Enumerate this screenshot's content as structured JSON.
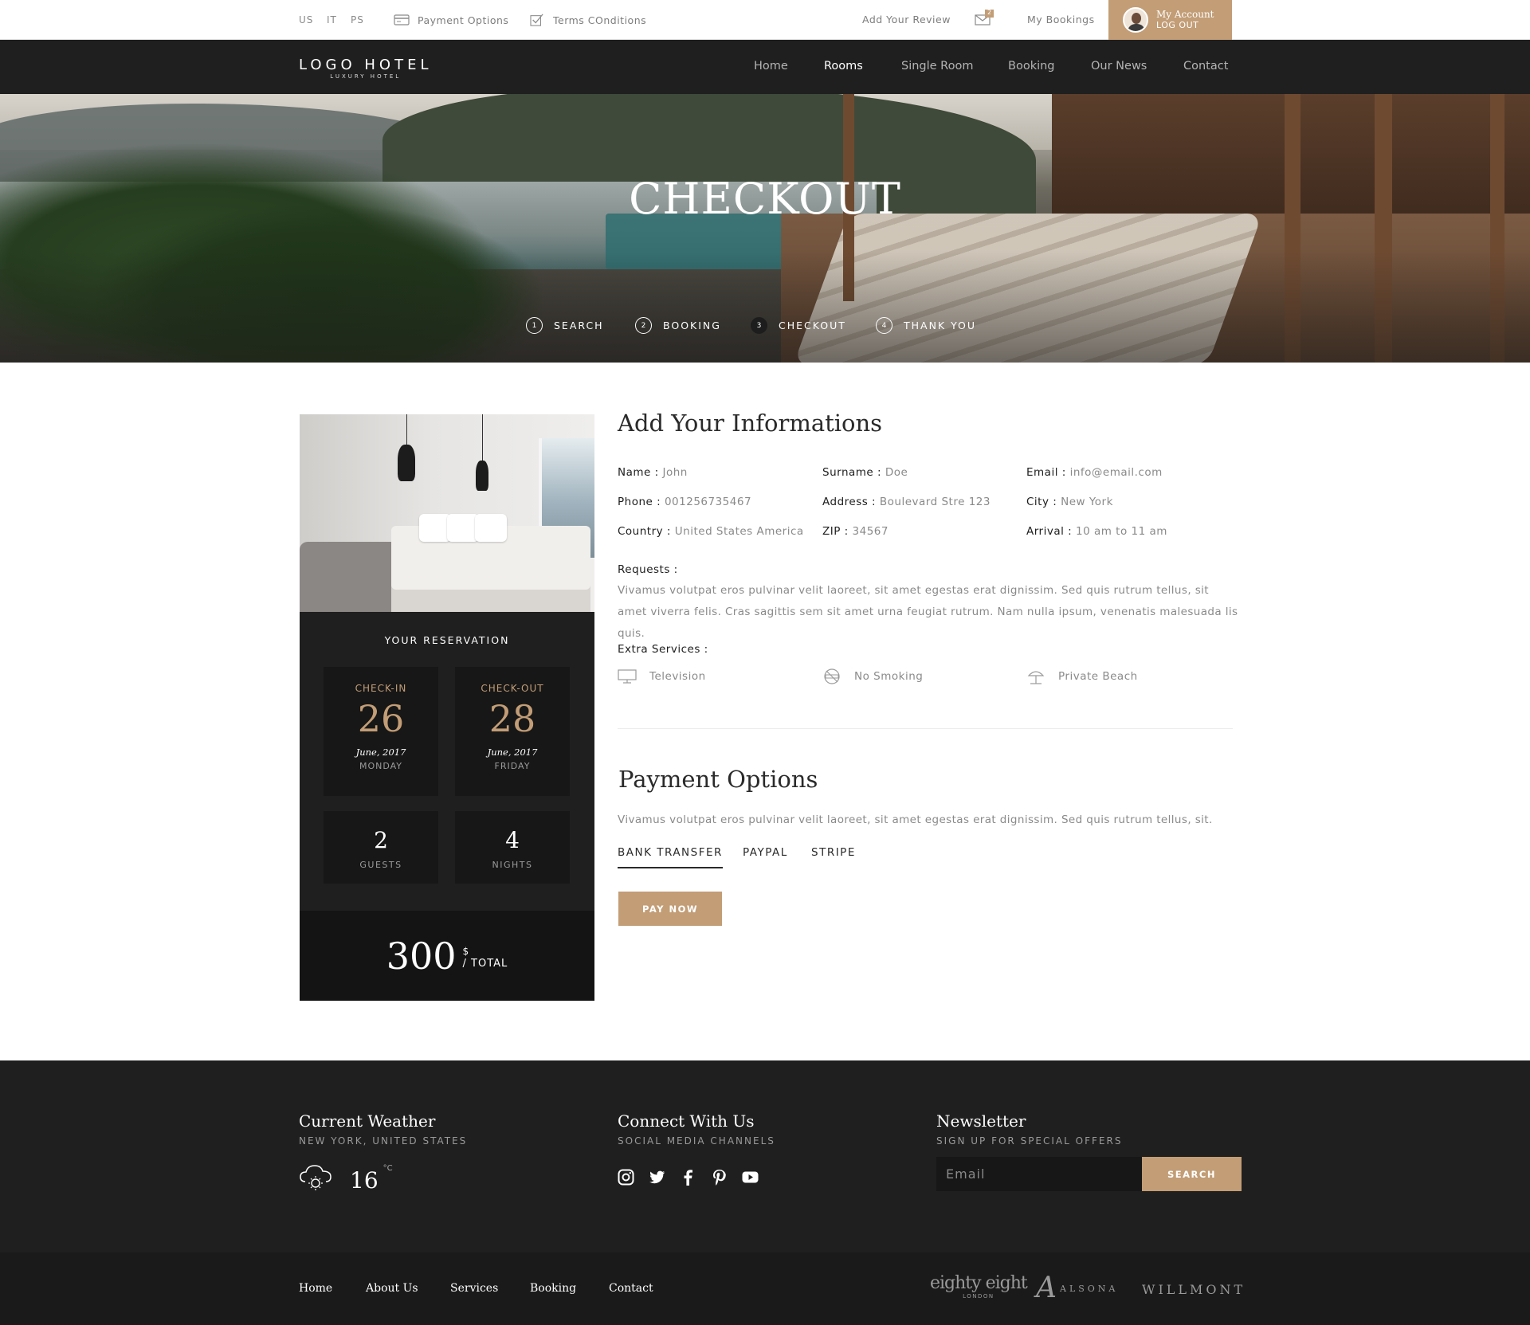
{
  "topbar": {
    "languages": [
      "US",
      "IT",
      "PS"
    ],
    "payment_options": "Payment Options",
    "terms": "Terms COnditions",
    "add_review": "Add Your Review",
    "messages_count": "2",
    "my_bookings": "My Bookings",
    "account_name": "My Account",
    "logout": "LOG OUT",
    "icons": {
      "payment": "credit-card-icon",
      "terms": "checkbox-icon",
      "messages": "envelope-icon",
      "avatar": "avatar"
    }
  },
  "nav": {
    "logo_main": "LOGO HOTEL",
    "logo_sub": "LUXURY HOTEL",
    "items": [
      {
        "label": "Home",
        "active": false
      },
      {
        "label": "Rooms",
        "active": true
      },
      {
        "label": "Single Room",
        "active": false
      },
      {
        "label": "Booking",
        "active": false
      },
      {
        "label": "Our News",
        "active": false
      },
      {
        "label": "Contact",
        "active": false
      }
    ]
  },
  "hero": {
    "title": "CHECKOUT",
    "steps": [
      {
        "num": "1",
        "label": "SEARCH",
        "active": false
      },
      {
        "num": "2",
        "label": "BOOKING",
        "active": false
      },
      {
        "num": "3",
        "label": "CHECKOUT",
        "active": true
      },
      {
        "num": "4",
        "label": "THANK YOU",
        "active": false
      }
    ]
  },
  "reservation": {
    "title": "YOUR RESERVATION",
    "checkin": {
      "label": "CHECK-IN",
      "day": "26",
      "month_year": "June, 2017",
      "weekday": "MONDAY"
    },
    "checkout": {
      "label": "CHECK-OUT",
      "day": "28",
      "month_year": "June, 2017",
      "weekday": "FRIDAY"
    },
    "guests": {
      "value": "2",
      "label": "GUESTS"
    },
    "nights": {
      "value": "4",
      "label": "NIGHTS"
    },
    "total": {
      "amount": "300",
      "currency": "$",
      "label": "/ TOTAL"
    }
  },
  "info": {
    "title": "Add Your Informations",
    "fields": {
      "name": {
        "label": "Name :",
        "value": "John"
      },
      "surname": {
        "label": "Surname :",
        "value": "Doe"
      },
      "email": {
        "label": "Email :",
        "value": "info@email.com"
      },
      "phone": {
        "label": "Phone :",
        "value": "001256735467"
      },
      "address": {
        "label": "Address :",
        "value": "Boulevard Stre 123"
      },
      "city": {
        "label": "City :",
        "value": "New York"
      },
      "country": {
        "label": "Country :",
        "value": "United States America"
      },
      "zip": {
        "label": "ZIP :",
        "value": "34567"
      },
      "arrival": {
        "label": "Arrival :",
        "value": "10 am to 11 am"
      }
    },
    "requests_label": "Requests :",
    "requests_text": "Vivamus volutpat eros pulvinar velit laoreet, sit amet egestas erat dignissim. Sed quis rutrum tellus, sit amet viverra felis. Cras sagittis sem sit amet urna feugiat rutrum. Nam nulla ipsum, venenatis malesuada lis quis.",
    "extra_label": "Extra Services :",
    "extras": [
      {
        "icon": "television-icon",
        "label": "Television"
      },
      {
        "icon": "no-smoking-icon",
        "label": "No Smoking"
      },
      {
        "icon": "beach-umbrella-icon",
        "label": "Private Beach"
      }
    ]
  },
  "payment": {
    "title": "Payment Options",
    "text": "Vivamus volutpat eros pulvinar velit laoreet, sit amet egestas erat dignissim. Sed quis rutrum tellus, sit.",
    "tabs": [
      {
        "label": "BANK TRANSFER",
        "active": true
      },
      {
        "label": "PAYPAL",
        "active": false
      },
      {
        "label": "STRIPE",
        "active": false
      }
    ],
    "pay_button": "PAY NOW"
  },
  "footer": {
    "weather": {
      "title": "Current Weather",
      "subtitle": "NEW YORK, UNITED STATES",
      "temp": "16",
      "unit": "°C",
      "icon": "cloud-sun-icon"
    },
    "connect": {
      "title": "Connect With Us",
      "subtitle": "SOCIAL MEDIA CHANNELS",
      "icons": [
        "instagram-icon",
        "twitter-icon",
        "facebook-icon",
        "pinterest-icon",
        "youtube-icon"
      ]
    },
    "newsletter": {
      "title": "Newsletter",
      "subtitle": "SIGN UP FOR SPECIAL OFFERS",
      "placeholder": "Email",
      "button": "SEARCH"
    },
    "links": [
      "Home",
      "About Us",
      "Services",
      "Booking",
      "Contact"
    ],
    "partners": {
      "p1": "eighty eight",
      "p1_sub": "LONDON",
      "p2": "ALSONA",
      "p3": "WILLMONT"
    }
  },
  "colors": {
    "accent": "#c29d76",
    "dark": "#1f1f1f",
    "text_muted": "#8a8a8a"
  }
}
